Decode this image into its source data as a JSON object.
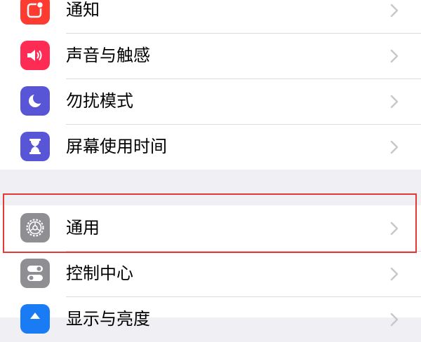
{
  "settings": {
    "group1": [
      {
        "label": "通知",
        "icon": "notifications-icon",
        "color": "#fe3b30"
      },
      {
        "label": "声音与触感",
        "icon": "speaker-icon",
        "color": "#fe2c55"
      },
      {
        "label": "勿扰模式",
        "icon": "moon-icon",
        "color": "#5856d6"
      },
      {
        "label": "屏幕使用时间",
        "icon": "hourglass-icon",
        "color": "#5856d6"
      }
    ],
    "group2": [
      {
        "label": "通用",
        "icon": "gear-icon",
        "color": "#8e8e93"
      },
      {
        "label": "控制中心",
        "icon": "toggles-icon",
        "color": "#8e8e93"
      },
      {
        "label": "显示与亮度",
        "icon": "display-icon",
        "color": "#1a7cf5"
      }
    ]
  },
  "highlight_color": "#e53935"
}
